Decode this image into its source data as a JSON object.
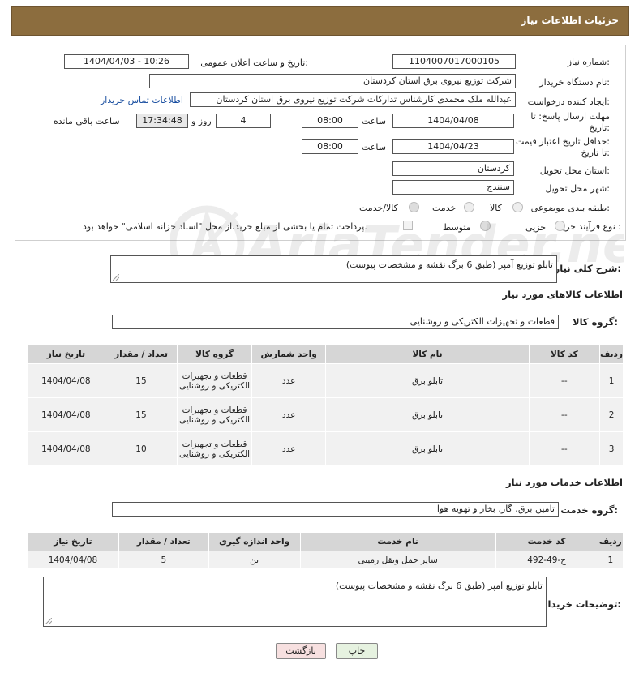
{
  "header": {
    "title": "جزئیات اطلاعات نیاز"
  },
  "form": {
    "need_number": {
      "label": "شماره نیاز:",
      "value": "1104007017000105"
    },
    "announce": {
      "label": "تاریخ و ساعت اعلان عمومی:",
      "value": "1404/04/03 - 10:26"
    },
    "buyer_org": {
      "label": "نام دستگاه خریدار:",
      "value": "شرکت توزیع نیروی برق استان کردستان"
    },
    "requester": {
      "label": "ایجاد کننده درخواست:",
      "value": "عبدالله ملک محمدی کارشناس تدارکات شرکت توزیع نیروی برق استان کردستان",
      "contact_link": "اطلاعات تماس خریدار"
    },
    "deadline": {
      "label_line1": "مهلت ارسال پاسخ: تا",
      "label_line2": "تاریخ:",
      "date": "1404/04/08",
      "time_label": "ساعت",
      "time": "08:00",
      "days": "4",
      "days_label": "روز و",
      "remaining": "17:34:48",
      "remaining_label": "ساعت باقی مانده"
    },
    "validity": {
      "label_line1": "حداقل تاریخ اعتبار قیمت:",
      "label_line2": "تا تاریخ:",
      "date": "1404/04/23",
      "time_label": "ساعت",
      "time": "08:00"
    },
    "province": {
      "label": "استان محل تحویل:",
      "value": "کردستان"
    },
    "city": {
      "label": "شهر محل تحویل:",
      "value": "سنندج"
    },
    "category": {
      "label": "طبقه بندی موضوعی:",
      "options": [
        "کالا",
        "خدمت",
        "کالا/خدمت"
      ]
    },
    "process": {
      "label": "نوع فرآیند خرید :",
      "options": [
        "جزیی",
        "متوسط"
      ],
      "payment_note": "پرداخت تمام یا بخشی از مبلغ خرید،از محل \"اسناد خزانه اسلامی\" خواهد بود."
    }
  },
  "description": {
    "label": "شرح کلی نیاز:",
    "value": "تابلو توزیع آمپر (طبق 6 برگ نقشه و مشخصات پیوست)"
  },
  "goods": {
    "section_title": "اطلاعات کالاهای مورد نیاز",
    "group_label": "گروه کالا:",
    "group_value": "قطعات و تجهیزات الکتریکی و روشنایی",
    "headers": [
      "ردیف",
      "کد کالا",
      "نام کالا",
      "واحد شمارش",
      "گروه کالا",
      "تعداد / مقدار",
      "تاریخ نیاز"
    ],
    "rows": [
      {
        "row": "1",
        "code": "--",
        "name": "تابلو برق",
        "unit": "عدد",
        "group": "قطعات و تجهیزات الکتریکی و روشنایی",
        "qty": "15",
        "date": "1404/04/08"
      },
      {
        "row": "2",
        "code": "--",
        "name": "تابلو برق",
        "unit": "عدد",
        "group": "قطعات و تجهیزات الکتریکی و روشنایی",
        "qty": "15",
        "date": "1404/04/08"
      },
      {
        "row": "3",
        "code": "--",
        "name": "تابلو برق",
        "unit": "عدد",
        "group": "قطعات و تجهیزات الکتریکی و روشنایی",
        "qty": "10",
        "date": "1404/04/08"
      }
    ]
  },
  "services": {
    "section_title": "اطلاعات خدمات مورد نیاز",
    "group_label": "گروه خدمت:",
    "group_value": "تامین برق، گاز، بخار و تهویه هوا",
    "headers": [
      "ردیف",
      "کد خدمت",
      "نام خدمت",
      "واحد اندازه گیری",
      "تعداد / مقدار",
      "تاریخ نیاز"
    ],
    "rows": [
      {
        "row": "1",
        "code": "ج-49-492",
        "name": "سایر حمل ونقل زمینی",
        "unit": "تن",
        "qty": "5",
        "date": "1404/04/08"
      }
    ]
  },
  "buyer_notes": {
    "label": "توضیحات خریدار:",
    "value": "تابلو توزیع آمپر (طبق 6 برگ نقشه و مشخصات پیوست)"
  },
  "buttons": {
    "print": "چاپ",
    "back": "بازگشت"
  },
  "watermark": "AriaTender.neT"
}
